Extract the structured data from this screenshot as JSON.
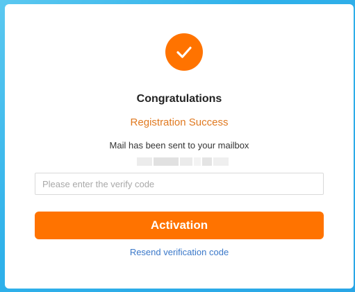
{
  "header": {
    "title": "Congratulations",
    "subtitle": "Registration Success"
  },
  "message": {
    "mail_note": "Mail has been sent to your mailbox"
  },
  "form": {
    "verify_placeholder": "Please enter the verify code",
    "verify_value": "",
    "activation_label": "Activation"
  },
  "links": {
    "resend_label": "Resend verification code"
  },
  "icons": {
    "success": "checkmark-icon"
  },
  "colors": {
    "accent": "#ff7300",
    "subtitle": "#e07920",
    "link": "#3a78c9",
    "background": "#2fb1ea"
  }
}
